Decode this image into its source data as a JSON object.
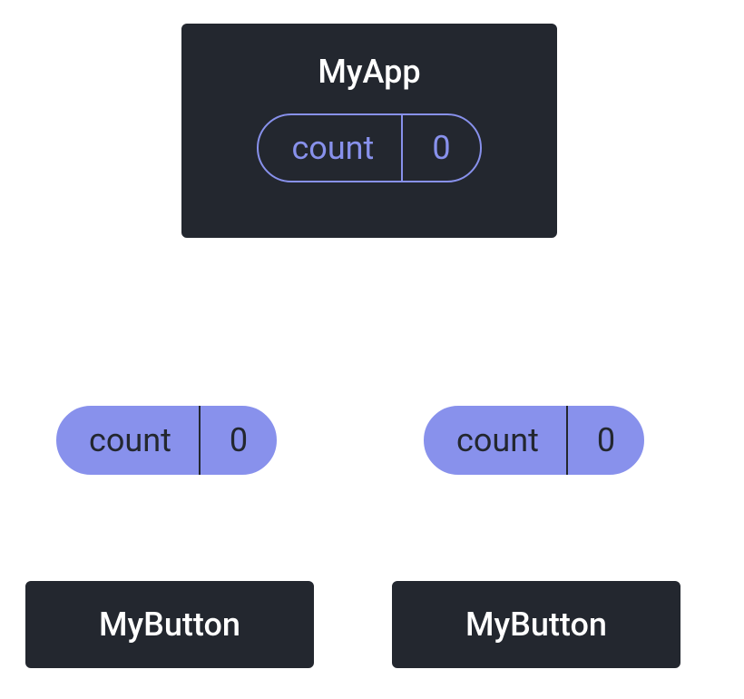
{
  "parent": {
    "title": "MyApp",
    "state": {
      "label": "count",
      "value": "0"
    }
  },
  "props": {
    "left": {
      "label": "count",
      "value": "0"
    },
    "right": {
      "label": "count",
      "value": "0"
    }
  },
  "children": {
    "left": {
      "title": "MyButton"
    },
    "right": {
      "title": "MyButton"
    }
  }
}
